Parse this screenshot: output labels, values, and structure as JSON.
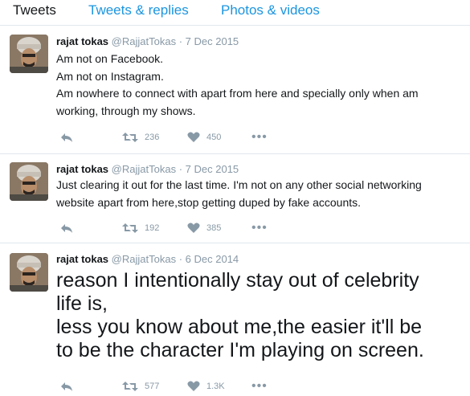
{
  "tabs": [
    "Tweets",
    "Tweets & replies",
    "Photos & videos"
  ],
  "tweets": [
    {
      "name": "rajat tokas",
      "handle": "@RajjatTokas",
      "dot": "·",
      "date": "7 Dec 2015",
      "lines": [
        "Am not on Facebook.",
        "Am not on Instagram.",
        "Am nowhere to connect with apart from here and specially only when am",
        "working, through my shows."
      ],
      "retweets": "236",
      "likes": "450"
    },
    {
      "name": "rajat tokas",
      "handle": "@RajjatTokas",
      "dot": "·",
      "date": "7 Dec 2015",
      "lines": [
        "Just clearing it out for the last time. I'm not on any other social networking",
        "website apart from here,stop getting duped by fake accounts."
      ],
      "retweets": "192",
      "likes": "385"
    },
    {
      "name": "rajat tokas",
      "handle": "@RajjatTokas",
      "dot": "·",
      "date": "6 Dec 2014",
      "lines": [
        "reason I intentionally stay out of celebrity",
        "life is,",
        "less you know about me,the easier it'll be",
        "to be the character I'm playing on screen."
      ],
      "retweets": "577",
      "likes": "1.3K"
    }
  ],
  "icons": {
    "reply": "reply-icon",
    "retweet": "retweet-icon",
    "like": "heart-icon",
    "more": "more-icon"
  },
  "colors": {
    "link": "#1b95e0",
    "muted": "#8899a6",
    "divider": "#e1e8ed"
  }
}
